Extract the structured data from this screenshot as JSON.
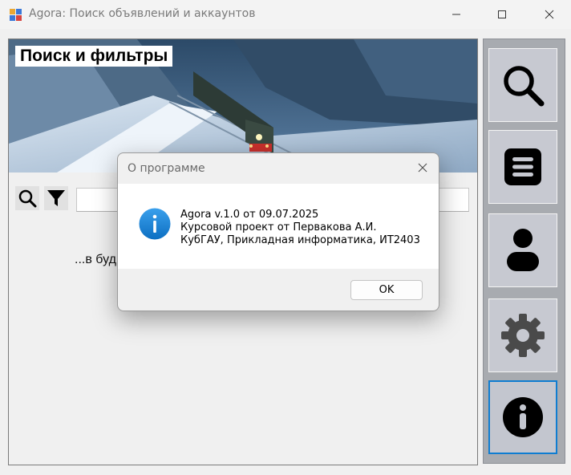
{
  "window": {
    "title": "Agora: Поиск объявлений и аккаунтов",
    "controls": {
      "minimize": "minimize-icon",
      "maximize": "maximize-icon",
      "close": "close-icon"
    }
  },
  "main": {
    "banner_title": "Поиск и фильтры",
    "banner_image": "winter-train-forest-photo",
    "toolbar": {
      "search_icon": "search-icon",
      "filter_icon": "filter-icon"
    },
    "search_input_value": "",
    "results_text": "...в буд"
  },
  "sidebar": {
    "items": [
      {
        "icon": "search-icon",
        "active": false
      },
      {
        "icon": "list-icon",
        "active": false
      },
      {
        "icon": "user-icon",
        "active": false
      },
      {
        "icon": "gear-icon",
        "active": false
      },
      {
        "icon": "info-icon",
        "active": true
      }
    ]
  },
  "dialog": {
    "title": "О программе",
    "icon": "info-icon",
    "lines": [
      "Agora v.1.0 от 09.07.2025",
      "Курсовой проект от Первакова А.И.",
      "КубГАУ, Прикладная информатика, ИТ2403"
    ],
    "ok_label": "OK"
  },
  "colors": {
    "accent": "#0f7dd1",
    "sidebar_bg": "#a8abb0",
    "nav_button_bg": "#c7c9d1",
    "info_icon": "#1a86d9"
  }
}
